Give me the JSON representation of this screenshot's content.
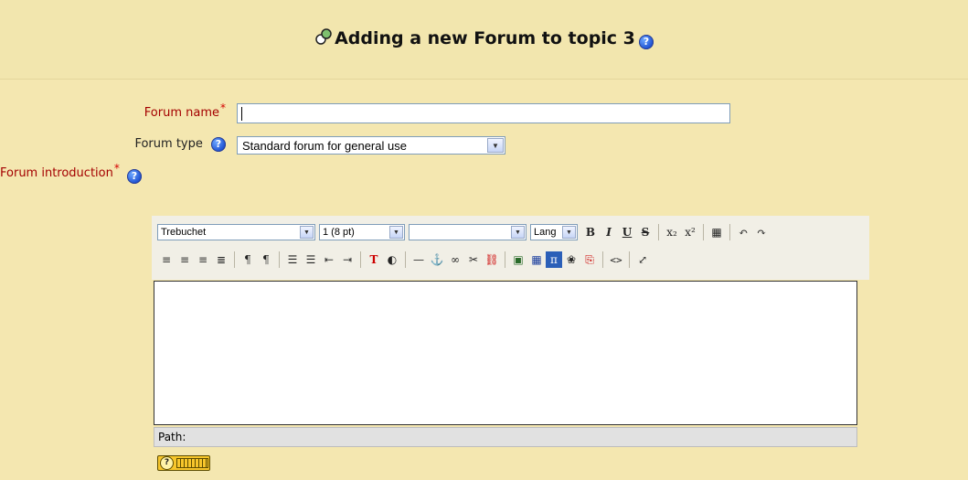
{
  "page": {
    "title": "Adding a new Forum to topic 3",
    "module_icon": "forum-module-icon",
    "help_icon": "help-icon"
  },
  "form": {
    "forum_name": {
      "label": "Forum name",
      "required_mark": "*",
      "value": ""
    },
    "forum_type": {
      "label": "Forum type",
      "selected": "Standard forum for general use"
    },
    "forum_intro": {
      "label": "Forum introduction",
      "required_mark": "*"
    }
  },
  "editor": {
    "font_family": "Trebuchet",
    "font_size": "1 (8 pt)",
    "format": "",
    "lang": "Lang",
    "buttons_row1": [
      "B",
      "I",
      "U",
      "S",
      "x₂",
      "x²",
      "▦",
      "↶",
      "↷"
    ],
    "buttons_row2": [
      "≡",
      "≡",
      "≡",
      "≣",
      "¶",
      "¶",
      "☰",
      "☰",
      "⇤",
      "⇥",
      "T",
      "◐",
      "—",
      "⚓",
      "∞",
      "✂",
      "⛓",
      "▣",
      "▦",
      "π",
      "❀",
      "⎘",
      "<>",
      "⤢"
    ],
    "path_label": "Path:"
  },
  "colors": {
    "background": "#f4e7b0",
    "required_label": "#a40000"
  }
}
